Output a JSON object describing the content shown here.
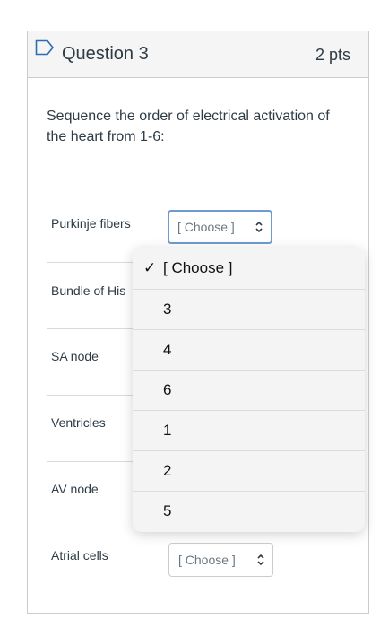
{
  "question": {
    "title": "Question 3",
    "points": "2 pts",
    "text": "Sequence the order of electrical activation of the heart from 1-6:"
  },
  "rows": [
    {
      "label": "Purkinje fibers",
      "selected": "[ Choose ]"
    },
    {
      "label": "Bundle of His",
      "selected": "[ Choose ]"
    },
    {
      "label": "SA node",
      "selected": "[ Choose ]"
    },
    {
      "label": "Ventricles",
      "selected": "[ Choose ]"
    },
    {
      "label": "AV node",
      "selected": "[ Choose ]"
    },
    {
      "label": "Atrial cells",
      "selected": "[ Choose ]"
    }
  ],
  "dropdown": {
    "check": "✓",
    "options": [
      "[ Choose ]",
      "3",
      "4",
      "6",
      "1",
      "2",
      "5"
    ],
    "checked_index": 0
  },
  "colors": {
    "focus_border": "#6f9bd1",
    "header_bg": "#f5f5f5",
    "text": "#2d3b45"
  },
  "icons": {
    "flag": "flag-icon",
    "select_arrows": "up-down-chevron-icon",
    "check": "check-icon"
  }
}
